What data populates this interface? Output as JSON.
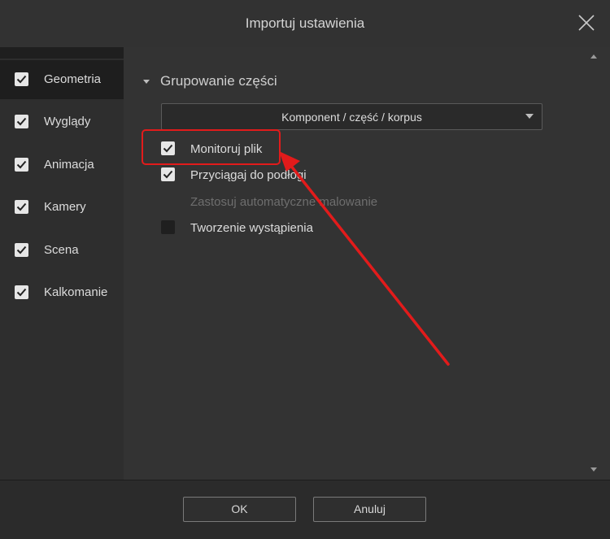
{
  "window": {
    "title": "Importuj ustawienia",
    "close_icon": "close-icon"
  },
  "sidebar": {
    "items": [
      {
        "label": "Geometria",
        "checked": true,
        "active": true
      },
      {
        "label": "Wyglądy",
        "checked": true,
        "active": false
      },
      {
        "label": "Animacja",
        "checked": true,
        "active": false
      },
      {
        "label": "Kamery",
        "checked": true,
        "active": false
      },
      {
        "label": "Scena",
        "checked": true,
        "active": false
      },
      {
        "label": "Kalkomanie",
        "checked": true,
        "active": false
      }
    ]
  },
  "main": {
    "section_title": "Grupowanie części",
    "dropdown_value": "Komponent / część / korpus",
    "options": [
      {
        "label": "Monitoruj plik",
        "checked": true,
        "enabled": true
      },
      {
        "label": "Przyciągaj do podłogi",
        "checked": true,
        "enabled": true
      },
      {
        "label": "Zastosuj automatyczne malowanie",
        "checked": false,
        "enabled": false
      },
      {
        "label": "Tworzenie wystąpienia",
        "checked": false,
        "enabled": true
      }
    ]
  },
  "footer": {
    "ok_label": "OK",
    "cancel_label": "Anuluj"
  },
  "colors": {
    "accent_annotation": "#e21b1b",
    "dialog_bg": "#2b2b2b"
  }
}
